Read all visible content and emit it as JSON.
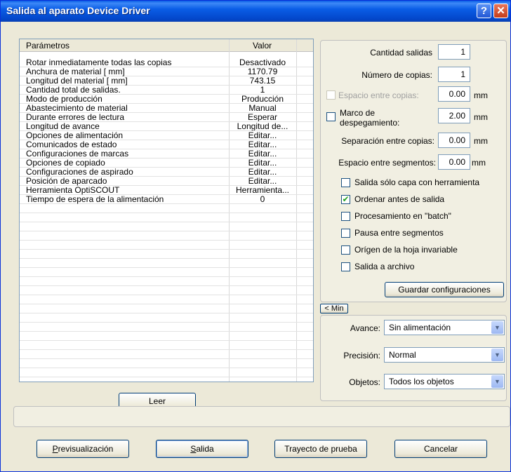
{
  "window": {
    "title": "Salida al aparato Device Driver",
    "help": "?",
    "close": "✕"
  },
  "params": {
    "header": {
      "param": "Parámetros",
      "value": "Valor"
    },
    "rows": [
      {
        "param": "Rotar inmediatamente todas las copias",
        "value": "Desactivado"
      },
      {
        "param": "Anchura de material [ mm]",
        "value": "1170.79"
      },
      {
        "param": "Longitud del material [ mm]",
        "value": "743.15"
      },
      {
        "param": "Cantidad total de salidas.",
        "value": "1"
      },
      {
        "param": "Modo de producción",
        "value": "Producción"
      },
      {
        "param": "Abastecimiento de material",
        "value": "Manual"
      },
      {
        "param": "Durante errores de lectura",
        "value": "Esperar"
      },
      {
        "param": "Longitud de avance",
        "value": "Longitud de..."
      },
      {
        "param": "Opciones de alimentación",
        "value": "Editar..."
      },
      {
        "param": "Comunicados de estado",
        "value": "Editar..."
      },
      {
        "param": "Configuraciones de marcas",
        "value": "Editar..."
      },
      {
        "param": "Opciones de copiado",
        "value": "Editar..."
      },
      {
        "param": "Configuraciones de aspirado",
        "value": "Editar..."
      },
      {
        "param": "Posición de aparcado",
        "value": "Editar..."
      },
      {
        "param": "Herramienta OptiSCOUT",
        "value": "Herramienta..."
      },
      {
        "param": "Tiempo de espera de la alimentación",
        "value": "0"
      }
    ],
    "read_button": "Leer"
  },
  "settings": {
    "cantidad_label": "Cantidad salidas",
    "cantidad_value": "1",
    "copias_label": "Número de copias:",
    "copias_value": "1",
    "espacio_copias_label": "Espacio entre copias:",
    "espacio_copias_value": "0.00",
    "marco_label1": "Marco de",
    "marco_label2": "despegamiento:",
    "marco_value": "2.00",
    "separacion_label": "Separación entre copias:",
    "separacion_value": "0.00",
    "espacio_seg_label": "Espacio entre segmentos:",
    "espacio_seg_value": "0.00",
    "unit": "mm",
    "checkboxes": [
      {
        "label": "Salida sólo capa con herramienta",
        "checked": false
      },
      {
        "label": "Ordenar antes de salida",
        "checked": true
      },
      {
        "label": "Procesamiento en \"batch\"",
        "checked": false
      },
      {
        "label": "Pausa entre segmentos",
        "checked": false
      },
      {
        "label": "Orígen de la hoja invariable",
        "checked": false
      },
      {
        "label": "Salida a archivo",
        "checked": false
      }
    ],
    "save_button": "Guardar configuraciones",
    "min_button": "< Min"
  },
  "options": {
    "avance_label": "Avance:",
    "avance_value": "Sin alimentación",
    "precision_label": "Precisión:",
    "precision_value": "Normal",
    "objetos_label": "Objetos:",
    "objetos_value": "Todos los objetos"
  },
  "buttons": {
    "preview_rest": "revisualización",
    "preview_key": "P",
    "output_rest": "alida",
    "output_key": "S",
    "test": "Trayecto de prueba",
    "cancel": "Cancelar"
  },
  "colors": {
    "titlebar": "#0a5de6",
    "background": "#ece9d8",
    "check": "#21a121"
  }
}
